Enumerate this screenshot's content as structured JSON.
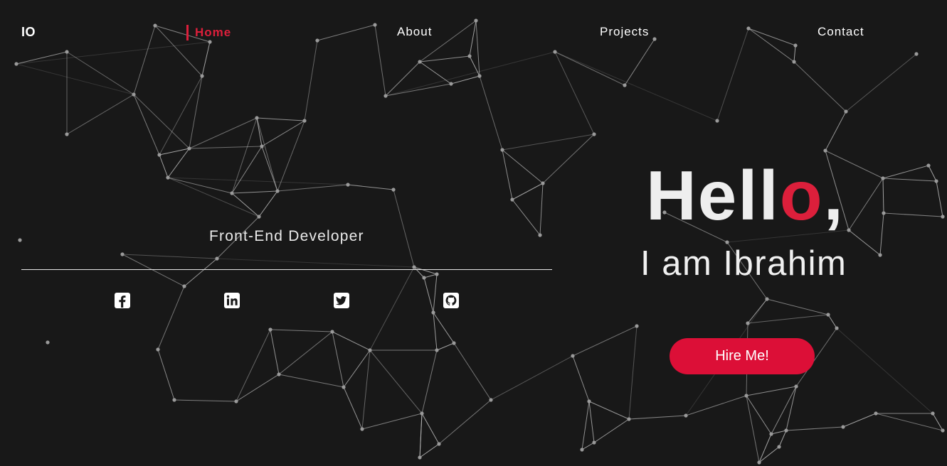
{
  "brand": {
    "logo": "IO"
  },
  "nav": {
    "items": [
      {
        "label": "Home",
        "active": true
      },
      {
        "label": "About",
        "active": false
      },
      {
        "label": "Projects",
        "active": false
      },
      {
        "label": "Contact",
        "active": false
      }
    ]
  },
  "profile": {
    "role": "Front-End Developer",
    "greeting_main": "Hell",
    "greeting_accent": "o",
    "greeting_tail": ",",
    "intro": "I am Ibrahim"
  },
  "social": [
    {
      "icon": "facebook-icon"
    },
    {
      "icon": "linkedin-icon"
    },
    {
      "icon": "twitter-icon"
    },
    {
      "icon": "github-icon"
    }
  ],
  "cta": {
    "label": "Hire Me!"
  },
  "colors": {
    "background": "#181818",
    "accent": "#dc1f3b",
    "button": "#dc0f37",
    "text": "#ffffff",
    "network_line": "#bdbdbd",
    "network_node": "#9a9a9a"
  }
}
